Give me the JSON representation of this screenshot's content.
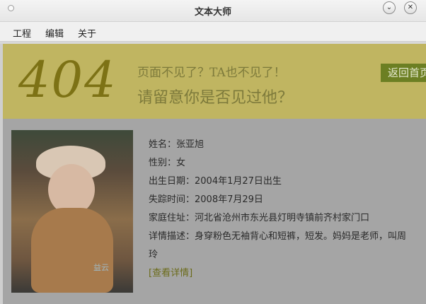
{
  "window": {
    "title": "文本大师",
    "minimize_symbol": "⌄",
    "close_symbol": "✕"
  },
  "menu": [
    "工程",
    "编辑",
    "关于"
  ],
  "banner": {
    "code": "404",
    "line1": "页面不见了？TA也不见了！",
    "line2": "请留意你是否见过他？",
    "back_button": "返回首页"
  },
  "person": {
    "photo_watermark": "益云",
    "name": "姓名：张亚旭",
    "gender": "性别：女",
    "birth": "出生日期：2004年1月27日出生",
    "missing": "失踪时间：2008年7月29日",
    "address": "家庭住址：河北省沧州市东光县灯明寺镇前齐村家门口",
    "detail_line1": "详情描述：身穿粉色无袖背心和短裤，短发。妈妈是老师，叫周",
    "detail_line2": "玲",
    "more_link": "[查看详情]"
  },
  "colors": {
    "banner_bg": "#c0b561",
    "content_bg": "#a5a5a5",
    "back_button_bg": "#6c7f23"
  }
}
